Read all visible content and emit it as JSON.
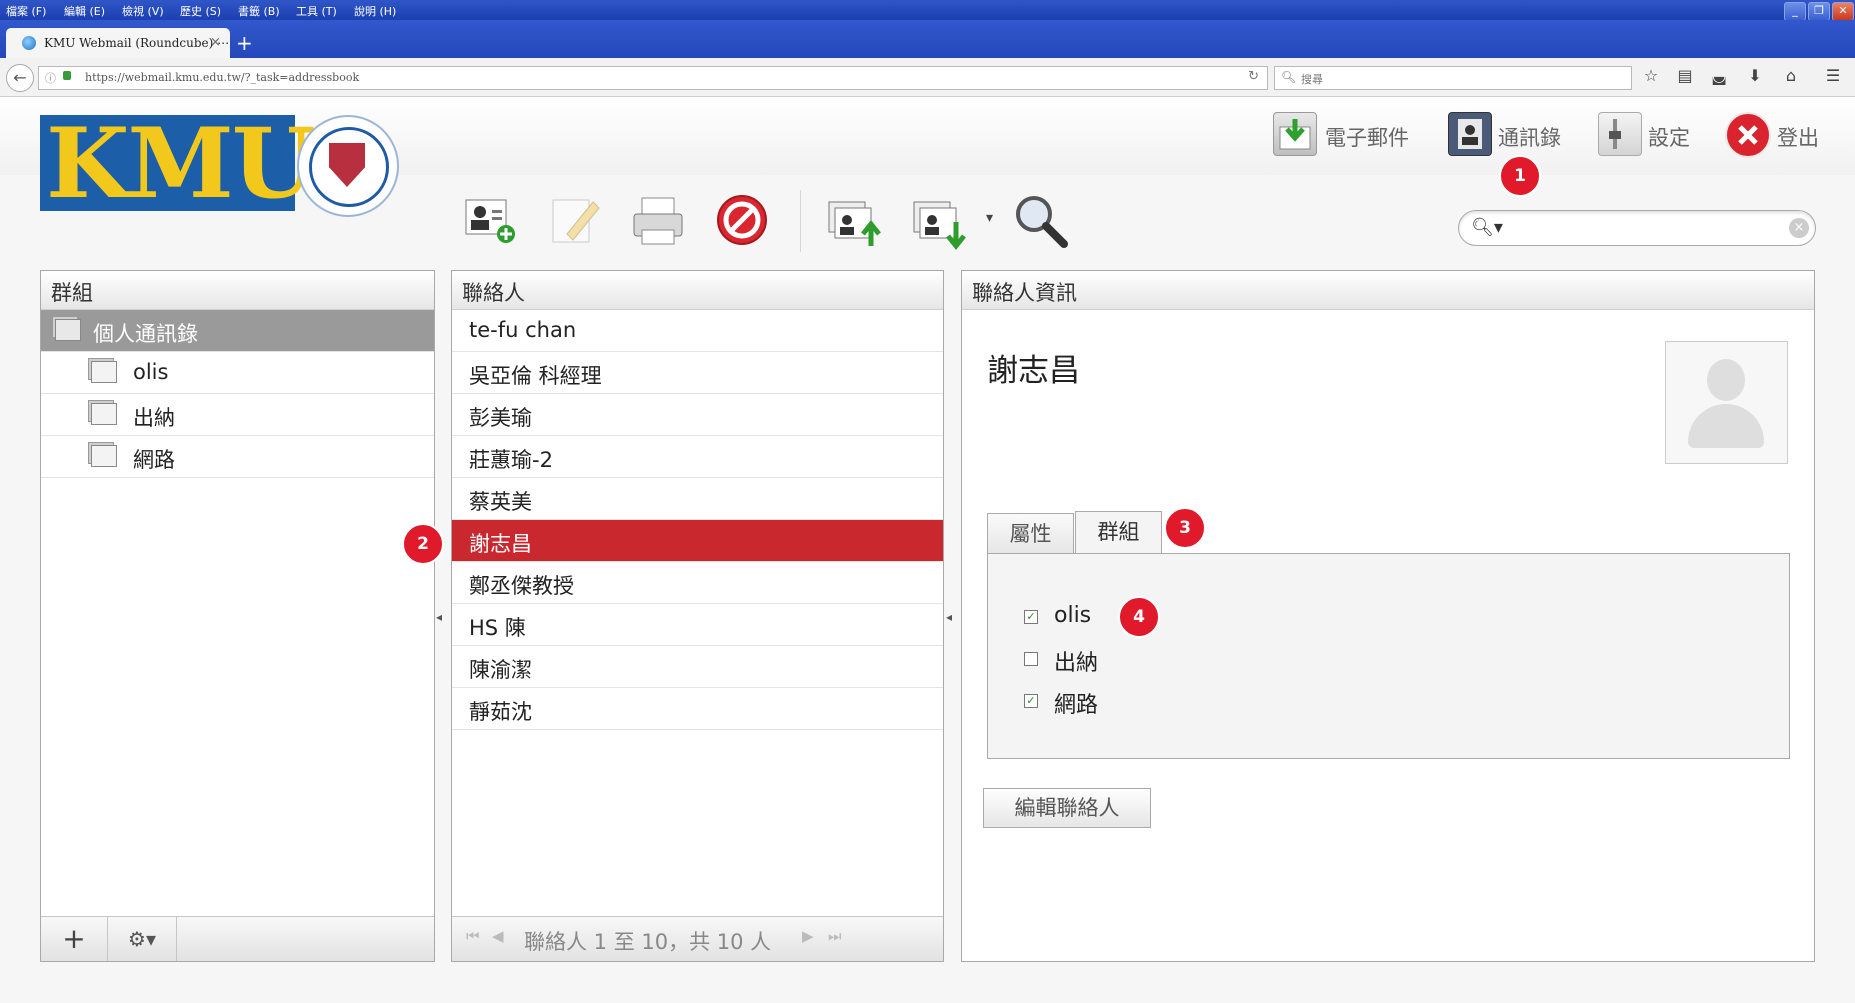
{
  "browser": {
    "menu": [
      "檔案 (F)",
      "編輯 (E)",
      "檢視 (V)",
      "歷史 (S)",
      "書籤 (B)",
      "工具 (T)",
      "說明 (H)"
    ],
    "tab_title": "KMU Webmail (Roundcube) ⋯",
    "tab_close": "×",
    "new_tab": "+",
    "url": "https://webmail.kmu.edu.tw/?_task=addressbook",
    "search_placeholder": "搜尋"
  },
  "header": {
    "logo_text": "KMU",
    "nav": [
      {
        "label": "電子郵件",
        "icon": "mail-download-icon"
      },
      {
        "label": "通訊錄",
        "icon": "addressbook-icon"
      },
      {
        "label": "設定",
        "icon": "settings-icon"
      },
      {
        "label": "登出",
        "icon": "logout-icon"
      }
    ]
  },
  "toolbar": {
    "buttons": [
      "add-contact-icon",
      "edit-contact-icon",
      "print-icon",
      "delete-icon",
      "import-icon",
      "export-icon",
      "search-icon"
    ],
    "export_dropdown": "▾"
  },
  "groups_panel": {
    "title": "群組",
    "items": [
      {
        "label": "個人通訊錄",
        "selected": true
      },
      {
        "label": "olis"
      },
      {
        "label": "出納"
      },
      {
        "label": "網路"
      }
    ],
    "footer": {
      "add": "+",
      "menu": "⚙▾"
    }
  },
  "contacts_panel": {
    "title": "聯絡人",
    "items": [
      "te-fu chan",
      "吳亞倫 科經理",
      "彭美瑜",
      "莊蕙瑜-2",
      "蔡英美",
      "謝志昌",
      "鄭丞傑教授",
      "HS 陳",
      "陳渝潔",
      "靜茹沈"
    ],
    "selected_index": 5,
    "footer": "聯絡人 1 至 10，共 10 人"
  },
  "contact_info": {
    "title": "聯絡人資訊",
    "name": "謝志昌",
    "tabs": [
      "屬性",
      "群組"
    ],
    "active_tab": "群組",
    "groups": [
      {
        "label": "olis",
        "checked": true
      },
      {
        "label": "出納",
        "checked": false
      },
      {
        "label": "網路",
        "checked": true
      }
    ],
    "edit_button": "編輯聯絡人"
  },
  "annotations": [
    "1",
    "2",
    "3",
    "4"
  ],
  "colors": {
    "selected_row": "#c8282e",
    "badge": "#e0192b",
    "logo_bg": "#1d5ea8",
    "logo_text": "#f2c81c"
  }
}
